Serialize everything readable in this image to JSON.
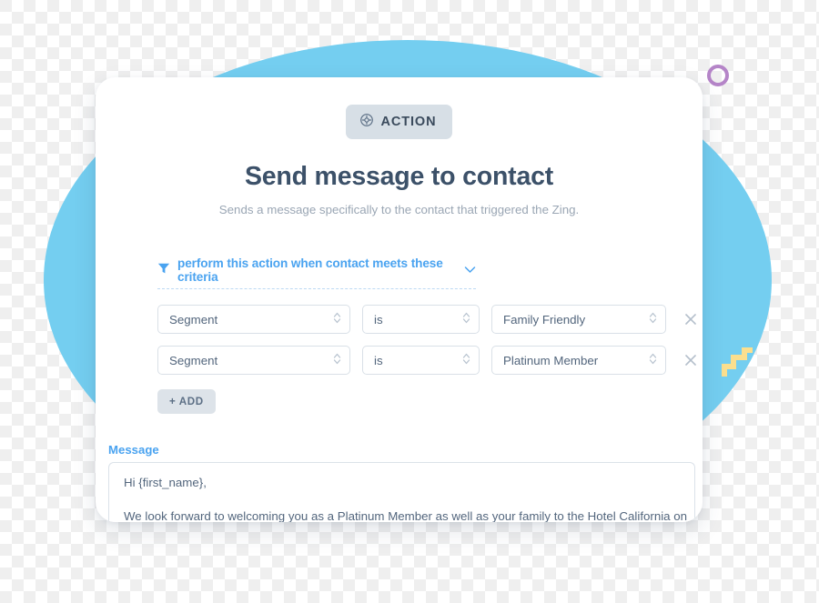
{
  "decor": {
    "blue_circle_color": "#74cef0",
    "purple_ring_color": "#b585c8",
    "yellow_zigzag_color": "#fbdf8e",
    "teal_triangle_color": "#b8e5de",
    "teal_donut_color": "#5cc8e0"
  },
  "card": {
    "badge": {
      "label": "ACTION",
      "icon": "gear-icon",
      "background": "#d7dfe6",
      "text_color": "#3a4a5c"
    },
    "title": "Send message to contact",
    "subtitle": "Sends a message specifically to the contact that triggered the Zing.",
    "criteria": {
      "filter_icon": "filter-icon",
      "link_label": "perform this action when contact meets these criteria",
      "link_color": "#4aa3f0",
      "chevron_icon": "chevron-down-icon",
      "rows": [
        {
          "field": "Segment",
          "operator": "is",
          "value": "Family Friendly",
          "remove_icon": "close-icon"
        },
        {
          "field": "Segment",
          "operator": "is",
          "value": "Platinum Member",
          "remove_icon": "close-icon"
        }
      ],
      "add_label": "+ ADD"
    },
    "message": {
      "label": "Message",
      "label_color": "#4aa3f0",
      "line1": "Hi {first_name},",
      "line2": "We look forward to welcoming you as a Platinum Member as well as your family to the Hotel California on",
      "toolbar": [
        {
          "icon": "file-icon"
        },
        {
          "icon": "curly-braces-icon"
        },
        {
          "icon": "image-icon"
        },
        {
          "icon": "emoji-icon"
        }
      ]
    }
  }
}
